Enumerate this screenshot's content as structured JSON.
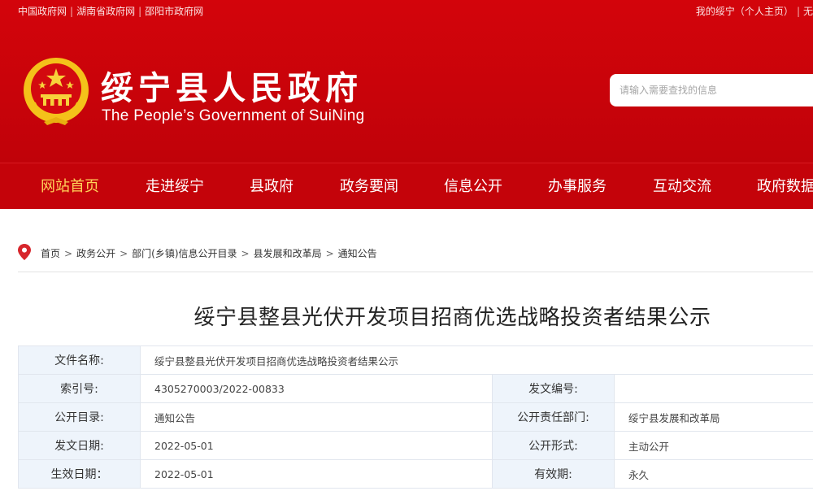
{
  "top": {
    "links": [
      "中国政府网",
      "湖南省政府网",
      "邵阳市政府网"
    ],
    "right_links": [
      "我的绥宁（个人主页）",
      "无"
    ]
  },
  "site": {
    "title_cn": "绥宁县人民政府",
    "title_en": "The People’s Government of SuiNing"
  },
  "search": {
    "placeholder": "请输入需要查找的信息"
  },
  "nav": [
    "网站首页",
    "走进绥宁",
    "县政府",
    "政务要闻",
    "信息公开",
    "办事服务",
    "互动交流",
    "政府数据"
  ],
  "breadcrumb": [
    "首页",
    "政务公开",
    "部门(乡镇)信息公开目录",
    "县发展和改革局",
    "通知公告"
  ],
  "article": {
    "title": "绥宁县整县光伏开发项目招商优选战略投资者结果公示"
  },
  "info": {
    "file_name_label": "文件名称:",
    "file_name": "绥宁县整县光伏开发项目招商优选战略投资者结果公示",
    "index_label": "索引号:",
    "index": "4305270003/2022-00833",
    "doc_no_label": "发文编号:",
    "doc_no": "",
    "catalog_label": "公开目录:",
    "catalog": "通知公告",
    "dept_label": "公开责任部门:",
    "dept": "绥宁县发展和改革局",
    "issue_date_label": "发文日期:",
    "issue_date": "2022-05-01",
    "form_label": "公开形式:",
    "form": "主动公开",
    "effective_date_label": "生效日期：",
    "effective_date": "2022-05-01",
    "validity_label": "有效期:",
    "validity": "永久"
  },
  "colors": {
    "header_red": "#c8030a",
    "nav_active": "#ffd35a",
    "table_key_bg": "#eef4fb"
  }
}
